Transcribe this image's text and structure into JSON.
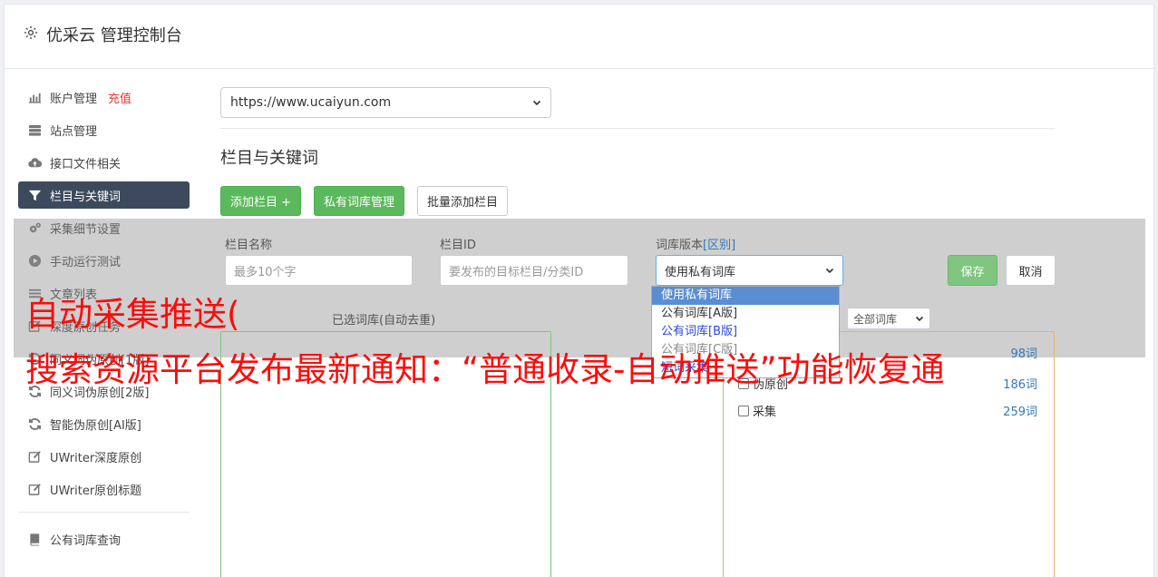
{
  "app": {
    "title": "优采云 管理控制台"
  },
  "sidebar": {
    "items": [
      {
        "label": "账户管理",
        "badge": "充值",
        "icon": "bar-chart-icon"
      },
      {
        "label": "站点管理",
        "icon": "server-icon"
      },
      {
        "label": "接口文件相关",
        "icon": "cloud-upload-icon"
      },
      {
        "label": "栏目与关键词",
        "icon": "filter-icon",
        "active": true
      },
      {
        "label": "采集细节设置",
        "icon": "cogs-icon"
      },
      {
        "label": "手动运行测试",
        "icon": "play-circle-icon"
      },
      {
        "label": "文章列表",
        "icon": "list-icon"
      },
      {
        "label": "深度原创任务",
        "icon": "edit-icon"
      },
      {
        "label": "同义词伪原创[1版]",
        "icon": "refresh-icon"
      },
      {
        "label": "同义词伪原创[2版]",
        "icon": "refresh-icon"
      },
      {
        "label": "智能伪原创[AI版]",
        "icon": "refresh-icon"
      },
      {
        "label": "UWriter深度原创",
        "icon": "edit-icon"
      },
      {
        "label": "UWriter原创标题",
        "icon": "edit-icon"
      },
      {
        "label": "公有词库查询",
        "icon": "book-icon"
      }
    ]
  },
  "main": {
    "site_select": "https://www.ucaiyun.com",
    "section_title": "栏目与关键词",
    "buttons": {
      "add_column": "添加栏目 +",
      "private_lib": "私有词库管理",
      "batch_add": "批量添加栏目"
    },
    "form": {
      "name_label": "栏目名称",
      "name_placeholder": "最多10个字",
      "id_label": "栏目ID",
      "id_placeholder": "要发布的目标栏目/分类ID",
      "lib_label": "词库版本",
      "lib_label_link": "[区别]",
      "lib_value": "使用私有词库",
      "save": "保存",
      "cancel": "取消"
    },
    "dropdown_options": [
      "使用私有词库",
      "公有词库[A版]",
      "公有词库[B版]",
      "公有词库[C版]",
      "短词采集"
    ],
    "selected_label": "已选词库(自动去重)",
    "filter_value": "全部词库",
    "libraries": [
      {
        "name": "伪原创",
        "count": "186词"
      },
      {
        "name": "采集",
        "count": "259词"
      }
    ],
    "partial_count": "98词"
  },
  "watermark": {
    "line1": "自动采集推送(",
    "line2": "搜索资源平台发布最新通知：“普通收录-自动推送”功能恢复通"
  }
}
